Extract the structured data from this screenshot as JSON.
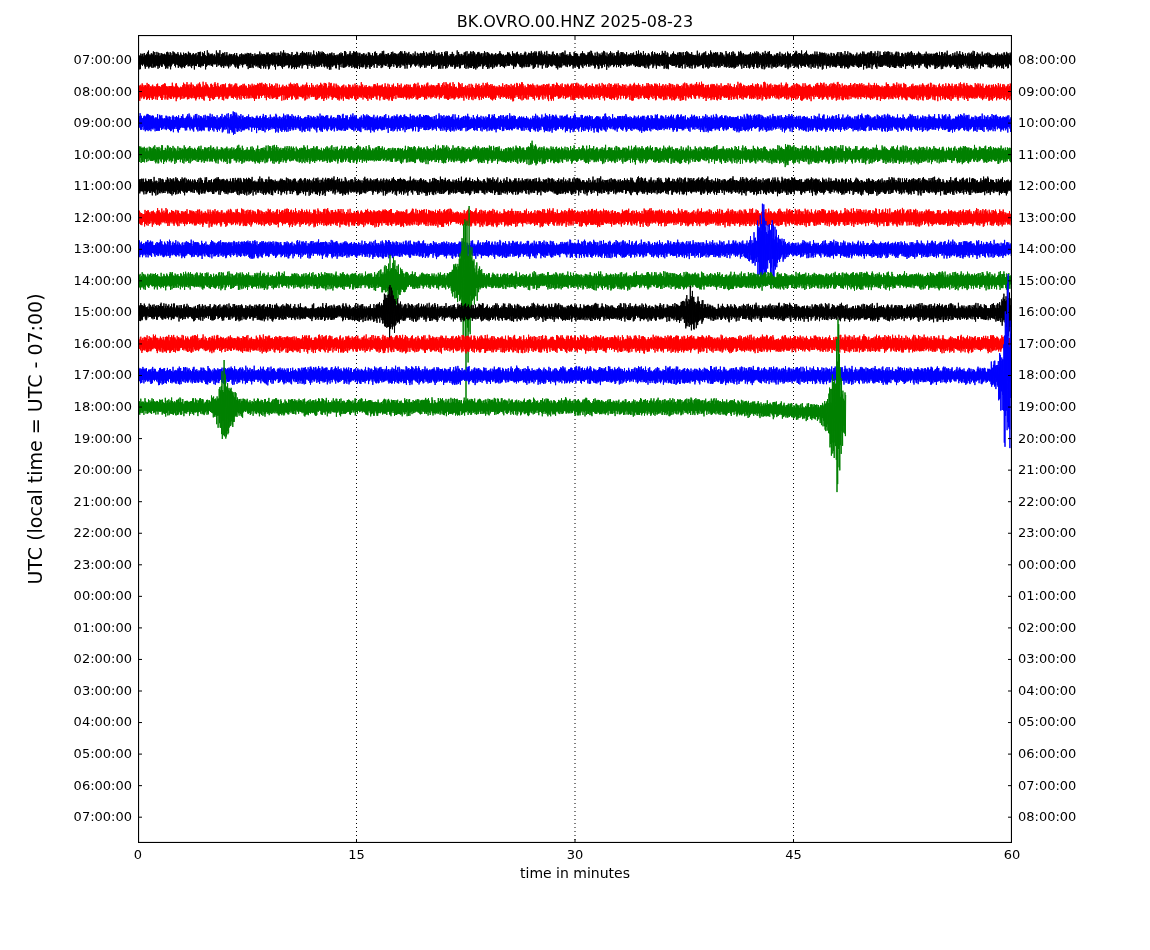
{
  "title": "BK.OVRO.00.HNZ 2025-08-23",
  "ylabel": "UTC (local time = UTC - 07:00)",
  "xlabel": "time in minutes",
  "xticks": [
    "0",
    "15",
    "30",
    "45",
    "60"
  ],
  "left_ticks": [
    "07:00:00",
    "08:00:00",
    "09:00:00",
    "10:00:00",
    "11:00:00",
    "12:00:00",
    "13:00:00",
    "14:00:00",
    "15:00:00",
    "16:00:00",
    "17:00:00",
    "18:00:00",
    "19:00:00",
    "20:00:00",
    "21:00:00",
    "22:00:00",
    "23:00:00",
    "00:00:00",
    "01:00:00",
    "02:00:00",
    "03:00:00",
    "04:00:00",
    "05:00:00",
    "06:00:00",
    "07:00:00"
  ],
  "right_ticks": [
    "08:00:00",
    "09:00:00",
    "10:00:00",
    "11:00:00",
    "12:00:00",
    "13:00:00",
    "14:00:00",
    "15:00:00",
    "16:00:00",
    "17:00:00",
    "18:00:00",
    "19:00:00",
    "20:00:00",
    "21:00:00",
    "22:00:00",
    "23:00:00",
    "00:00:00",
    "01:00:00",
    "02:00:00",
    "03:00:00",
    "04:00:00",
    "05:00:00",
    "06:00:00",
    "07:00:00",
    "08:00:00"
  ],
  "traces": [
    {
      "color": "#000000"
    },
    {
      "color": "#ff0000"
    },
    {
      "color": "#0000ff"
    },
    {
      "color": "#008000"
    },
    {
      "color": "#000000"
    },
    {
      "color": "#ff0000"
    },
    {
      "color": "#0000ff"
    },
    {
      "color": "#008000"
    },
    {
      "color": "#000000"
    },
    {
      "color": "#ff0000"
    },
    {
      "color": "#0000ff"
    },
    {
      "color": "#008000"
    }
  ]
}
